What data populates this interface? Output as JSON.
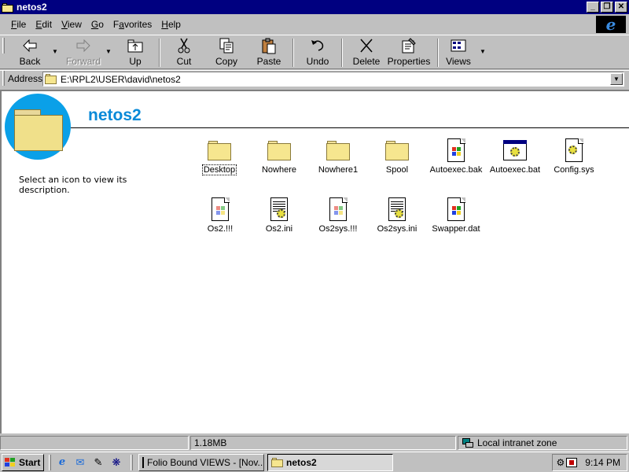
{
  "window": {
    "title": "netos2",
    "controls": {
      "minimize": "_",
      "restore": "❐",
      "close": "✕"
    }
  },
  "menu": [
    {
      "label": "File",
      "accel": "F",
      "rest": "ile"
    },
    {
      "label": "Edit",
      "accel": "E",
      "rest": "dit"
    },
    {
      "label": "View",
      "accel": "V",
      "rest": "iew"
    },
    {
      "label": "Go",
      "accel": "G",
      "rest": "o"
    },
    {
      "label": "Favorites",
      "accel": "a",
      "pre": "F",
      "rest": "vorites"
    },
    {
      "label": "Help",
      "accel": "H",
      "rest": "elp"
    }
  ],
  "toolbar": {
    "back": "Back",
    "forward": "Forward",
    "up": "Up",
    "cut": "Cut",
    "copy": "Copy",
    "paste": "Paste",
    "undo": "Undo",
    "delete": "Delete",
    "properties": "Properties",
    "views": "Views"
  },
  "address": {
    "label": "Address",
    "value": "E:\\RPL2\\USER\\david\\netos2"
  },
  "folder_view": {
    "title": "netos2",
    "info": "Select an icon to view its description.",
    "files_row1": [
      {
        "name": "Desktop",
        "icon": "folder-icon"
      },
      {
        "name": "Nowhere",
        "icon": "folder-icon"
      },
      {
        "name": "Nowhere1",
        "icon": "folder-icon"
      },
      {
        "name": "Spool",
        "icon": "folder-icon"
      },
      {
        "name": "Autoexec.bak",
        "icon": "windows-file-icon"
      },
      {
        "name": "Autoexec.bat",
        "icon": "batch-file-icon"
      },
      {
        "name": "Config.sys",
        "icon": "system-file-icon"
      }
    ],
    "files_row2": [
      {
        "name": "Os2.!!!",
        "icon": "windows-file-icon"
      },
      {
        "name": "Os2.ini",
        "icon": "config-settings-icon"
      },
      {
        "name": "Os2sys.!!!",
        "icon": "windows-file-icon"
      },
      {
        "name": "Os2sys.ini",
        "icon": "config-settings-icon"
      },
      {
        "name": "Swapper.dat",
        "icon": "windows-file-icon"
      }
    ]
  },
  "status": {
    "size": "1.18MB",
    "zone": "Local intranet zone"
  },
  "taskbar": {
    "start": "Start",
    "tasks": [
      {
        "label": "Folio Bound VIEWS - [Nov..."
      },
      {
        "label": "netos2"
      }
    ],
    "clock": "9:14 PM"
  },
  "colors": {
    "title_bar": "#000080",
    "heading": "#0a8ad8",
    "circle": "#0aa0e8",
    "face": "#c0c0c0"
  }
}
